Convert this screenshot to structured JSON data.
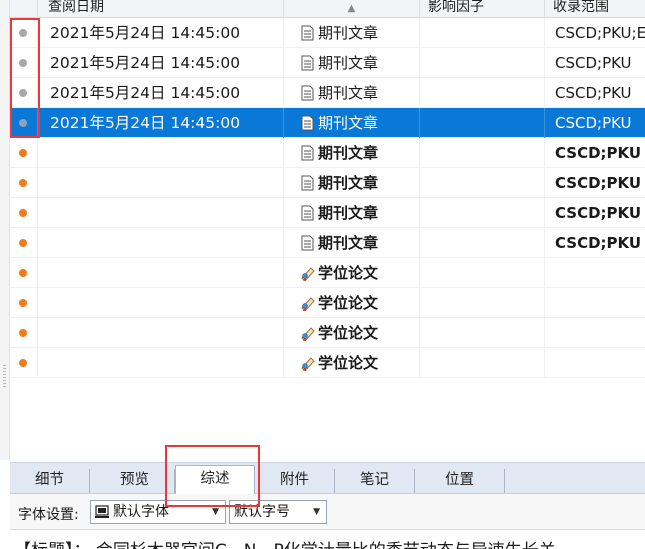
{
  "grid": {
    "columns": {
      "date": "查阅日期",
      "sort_indicator": "▲",
      "impact": "影响因子",
      "range": "收录范围"
    },
    "rows": [
      {
        "status": "read",
        "date": "2021年5月24日 14:45:00",
        "type": "期刊文章",
        "type_icon": "document-icon",
        "impact": "",
        "range": "CSCD;PKU;E",
        "bold": false,
        "selected": false
      },
      {
        "status": "read",
        "date": "2021年5月24日 14:45:00",
        "type": "期刊文章",
        "type_icon": "document-icon",
        "impact": "",
        "range": "CSCD;PKU",
        "bold": false,
        "selected": false
      },
      {
        "status": "read",
        "date": "2021年5月24日 14:45:00",
        "type": "期刊文章",
        "type_icon": "document-icon",
        "impact": "",
        "range": "CSCD;PKU",
        "bold": false,
        "selected": false
      },
      {
        "status": "read",
        "date": "2021年5月24日 14:45:00",
        "type": "期刊文章",
        "type_icon": "document-icon",
        "impact": "",
        "range": "CSCD;PKU",
        "bold": false,
        "selected": true
      },
      {
        "status": "unread",
        "date": "",
        "type": "期刊文章",
        "type_icon": "document-icon",
        "impact": "",
        "range": "CSCD;PKU",
        "bold": true,
        "selected": false
      },
      {
        "status": "unread",
        "date": "",
        "type": "期刊文章",
        "type_icon": "document-icon",
        "impact": "",
        "range": "CSCD;PKU",
        "bold": true,
        "selected": false
      },
      {
        "status": "unread",
        "date": "",
        "type": "期刊文章",
        "type_icon": "document-icon",
        "impact": "",
        "range": "CSCD;PKU",
        "bold": true,
        "selected": false
      },
      {
        "status": "unread",
        "date": "",
        "type": "期刊文章",
        "type_icon": "document-icon",
        "impact": "",
        "range": "CSCD;PKU",
        "bold": true,
        "selected": false
      },
      {
        "status": "unread",
        "date": "",
        "type": "学位论文",
        "type_icon": "diploma-icon",
        "impact": "",
        "range": "",
        "bold": true,
        "selected": false
      },
      {
        "status": "unread",
        "date": "",
        "type": "学位论文",
        "type_icon": "diploma-icon",
        "impact": "",
        "range": "",
        "bold": true,
        "selected": false
      },
      {
        "status": "unread",
        "date": "",
        "type": "学位论文",
        "type_icon": "diploma-icon",
        "impact": "",
        "range": "",
        "bold": true,
        "selected": false
      },
      {
        "status": "unread",
        "date": "",
        "type": "学位论文",
        "type_icon": "diploma-icon",
        "impact": "",
        "range": "",
        "bold": true,
        "selected": false
      }
    ]
  },
  "tabs": [
    {
      "label": "细节",
      "active": false
    },
    {
      "label": "预览",
      "active": false
    },
    {
      "label": "综述",
      "active": true
    },
    {
      "label": "附件",
      "active": false
    },
    {
      "label": "笔记",
      "active": false
    },
    {
      "label": "位置",
      "active": false
    }
  ],
  "toolbar": {
    "font_label": "字体设置:",
    "font_value": "默认字体",
    "size_value": "默认字号"
  },
  "preview": {
    "text": "【标题】：  会同杉木器官间C、N、P化学计量比的季节动态与异速生长关"
  },
  "colors": {
    "selection": "#0a78d7",
    "unread_dot": "#f07b1a",
    "read_dot": "#a8a8a8",
    "highlight_frame": "#e8383d"
  }
}
